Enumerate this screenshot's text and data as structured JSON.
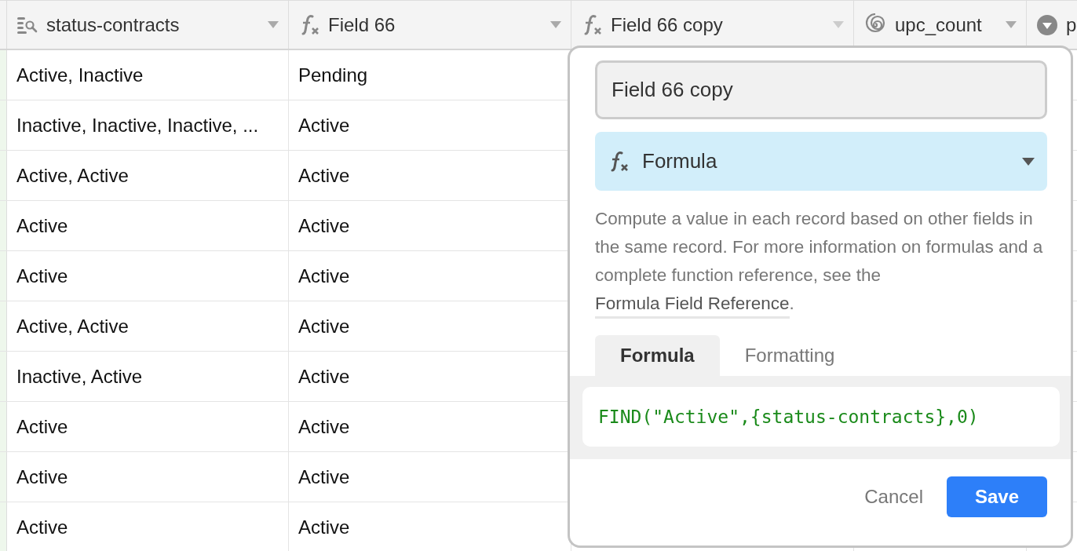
{
  "columns": [
    {
      "kind": "lookup",
      "label": "status-contracts"
    },
    {
      "kind": "formula",
      "label": "Field 66"
    },
    {
      "kind": "formula",
      "label": "Field 66 copy"
    },
    {
      "kind": "count",
      "label": "upc_count"
    },
    {
      "kind": "select",
      "label": "p"
    }
  ],
  "rows": [
    [
      "Active, Inactive",
      "Pending"
    ],
    [
      "Inactive, Inactive, Inactive, ...",
      "Active"
    ],
    [
      "Active, Active",
      "Active"
    ],
    [
      "Active",
      "Active"
    ],
    [
      "Active",
      "Active"
    ],
    [
      "Active, Active",
      "Active"
    ],
    [
      "Inactive, Active",
      "Active"
    ],
    [
      "Active",
      "Active"
    ],
    [
      "Active",
      "Active"
    ],
    [
      "Active",
      "Active"
    ]
  ],
  "popover": {
    "name_field": {
      "value": "Field 66 copy"
    },
    "type_select": {
      "label": "Formula"
    },
    "description": {
      "text": "Compute a value in each record based on other fields in the same record. For more information on formulas and a complete function reference, see the ",
      "link": "Formula Field Reference",
      "end": "."
    },
    "tabs": [
      {
        "label": "Formula",
        "selected": true
      },
      {
        "label": "Formatting",
        "selected": false
      }
    ],
    "formula": "FIND(\"Active\",{status-contracts},0)",
    "buttons": {
      "cancel": "Cancel",
      "save": "Save"
    }
  }
}
